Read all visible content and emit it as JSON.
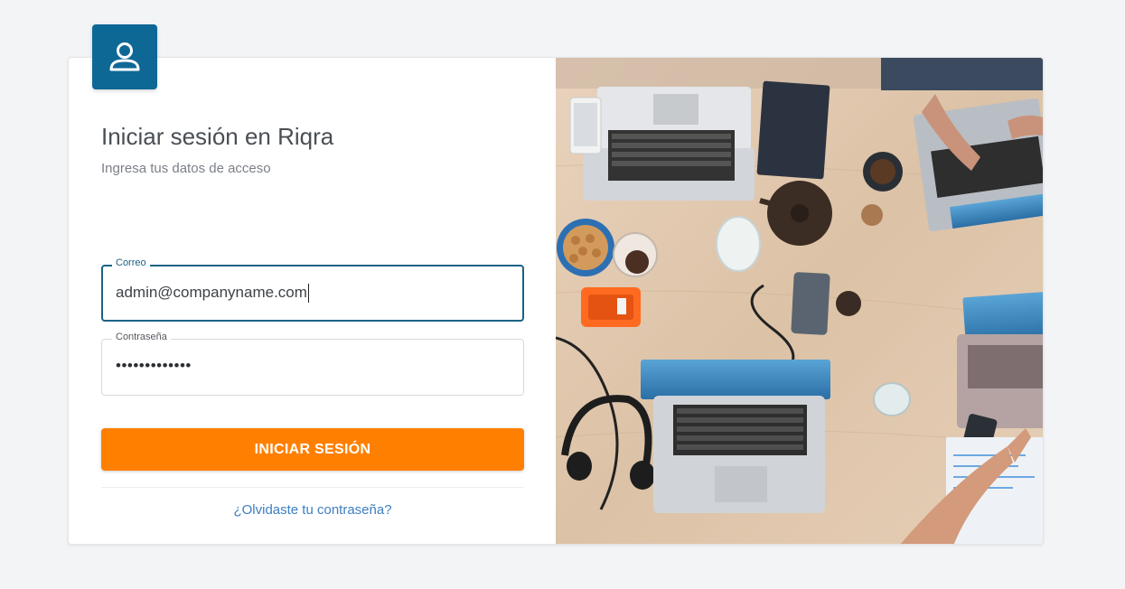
{
  "colors": {
    "brand": "#0e6896",
    "primary_button": "#ff8000",
    "link": "#3d7fbf",
    "focus_border": "#1a6387"
  },
  "header": {
    "icon": "user-icon",
    "title": "Iniciar sesión en Riqra",
    "subtitle": "Ingresa tus datos de acceso"
  },
  "form": {
    "email": {
      "label": "Correo",
      "value": "admin@companyname.com"
    },
    "password": {
      "label": "Contraseña",
      "masked_value": "•••••••••••••"
    },
    "submit_label": "INICIAR SESIÓN",
    "forgot_label": "¿Olvidaste tu contraseña?"
  },
  "illustration": {
    "description_icon": "office-desk-photo"
  }
}
